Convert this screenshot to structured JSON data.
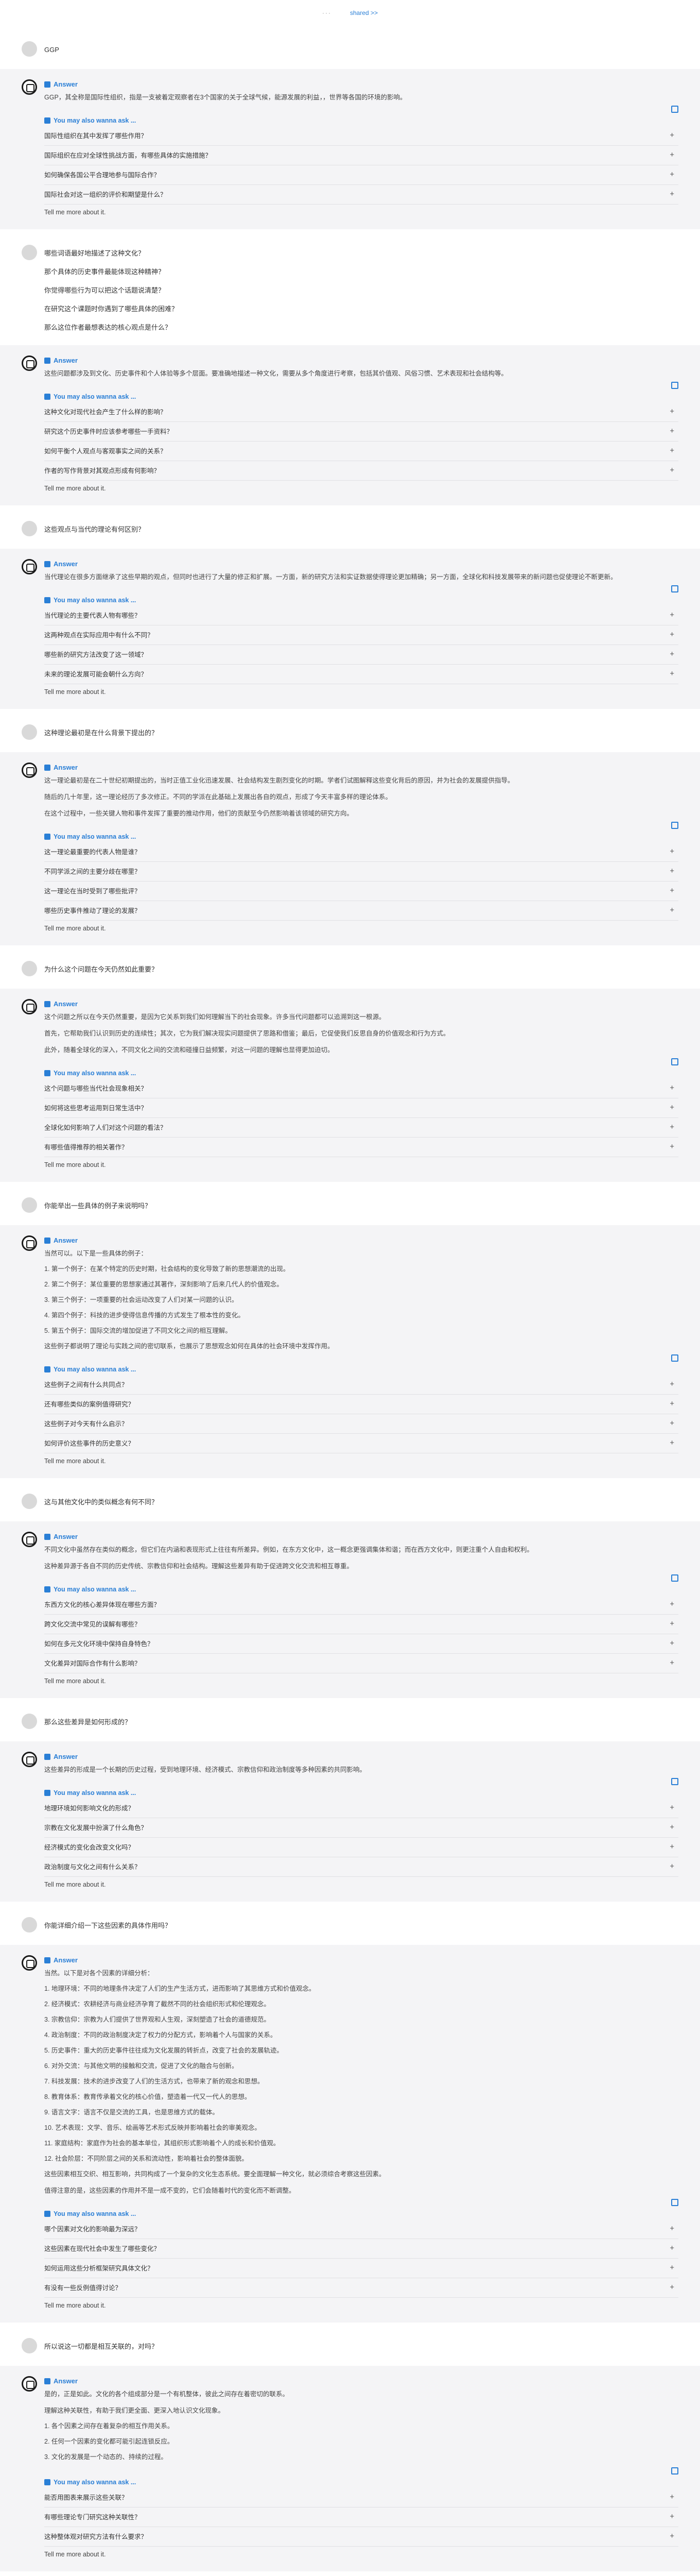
{
  "topbar": {
    "dots": "···",
    "label": "shared >>"
  },
  "labels": {
    "answer": "Answer",
    "ymal": "You may also wanna ask ...",
    "tell_more": "Tell me more about it.",
    "plus": "+"
  },
  "blocks": [
    {
      "question": [
        "GGP"
      ],
      "answer": [
        "GGP，其全称是国际性组织，指是一支被着定观察者在3个国家的关于全球气候，能源发展的利益，，世界等各国的环境的影响。"
      ],
      "suggestions": [
        "国际性组织在其中发挥了哪些作用？",
        "国际组织在应对全球性挑战方面，有哪些具体的实施措施？",
        "如何确保各国公平合理地参与国际合作？",
        "国际社会对这一组织的评价和期望是什么？"
      ]
    },
    {
      "question": [
        "哪些词语最好地描述了这种文化？",
        "那个具体的历史事件最能体现这种精神？",
        "你觉得哪些行为可以把这个话题说清楚？",
        "在研究这个课题时你遇到了哪些具体的困难？",
        "那么这位作者最想表达的核心观点是什么？"
      ],
      "answer": [
        "这些问题都涉及到文化、历史事件和个人体验等多个层面。要准确地描述一种文化，需要从多个角度进行考察，包括其价值观、风俗习惯、艺术表现和社会结构等。"
      ],
      "suggestions": [
        "这种文化对现代社会产生了什么样的影响？",
        "研究这个历史事件时应该参考哪些一手资料？",
        "如何平衡个人观点与客观事实之间的关系？",
        "作者的写作背景对其观点形成有何影响？"
      ]
    },
    {
      "question": [
        "这些观点与当代的理论有何区别？"
      ],
      "answer": [
        "当代理论在很多方面继承了这些早期的观点，但同时也进行了大量的修正和扩展。一方面，新的研究方法和实证数据使得理论更加精确；另一方面，全球化和科技发展带来的新问题也促使理论不断更新。"
      ],
      "suggestions": [
        "当代理论的主要代表人物有哪些？",
        "这两种观点在实际应用中有什么不同？",
        "哪些新的研究方法改变了这一领域？",
        "未来的理论发展可能会朝什么方向？"
      ]
    },
    {
      "question": [
        "这种理论最初是在什么背景下提出的？"
      ],
      "answer": [
        "这一理论最初是在二十世纪初期提出的，当时正值工业化迅速发展、社会结构发生剧烈变化的时期。学者们试图解释这些变化背后的原因，并为社会的发展提供指导。",
        "随后的几十年里，这一理论经历了多次修正。不同的学派在此基础上发展出各自的观点，形成了今天丰富多样的理论体系。",
        "在这个过程中，一些关键人物和事件发挥了重要的推动作用，他们的贡献至今仍然影响着该领域的研究方向。"
      ],
      "suggestions": [
        "这一理论最重要的代表人物是谁？",
        "不同学派之间的主要分歧在哪里？",
        "这一理论在当时受到了哪些批评？",
        "哪些历史事件推动了理论的发展？"
      ]
    },
    {
      "question": [
        "为什么这个问题在今天仍然如此重要？"
      ],
      "answer": [
        "这个问题之所以在今天仍然重要，是因为它关系到我们如何理解当下的社会现象。许多当代问题都可以追溯到这一根源。",
        "首先，它帮助我们认识到历史的连续性；其次，它为我们解决现实问题提供了思路和借鉴；最后，它促使我们反思自身的价值观念和行为方式。",
        "此外，随着全球化的深入，不同文化之间的交流和碰撞日益频繁，对这一问题的理解也显得更加迫切。"
      ],
      "suggestions": [
        "这个问题与哪些当代社会现象相关？",
        "如何将这些思考运用到日常生活中？",
        "全球化如何影响了人们对这个问题的看法？",
        "有哪些值得推荐的相关著作？"
      ]
    },
    {
      "question": [
        "你能举出一些具体的例子来说明吗？"
      ],
      "answer": [
        "当然可以。以下是一些具体的例子："
      ],
      "list": [
        "1. 第一个例子：在某个特定的历史时期，社会结构的变化导致了新的思想潮流的出现。",
        "2. 第二个例子：某位重要的思想家通过其著作，深刻影响了后来几代人的价值观念。",
        "3. 第三个例子：一项重要的社会运动改变了人们对某一问题的认识。",
        "4. 第四个例子：科技的进步使得信息传播的方式发生了根本性的变化。",
        "5. 第五个例子：国际交流的增加促进了不同文化之间的相互理解。"
      ],
      "answer2": [
        "这些例子都说明了理论与实践之间的密切联系，也展示了思想观念如何在具体的社会环境中发挥作用。"
      ],
      "suggestions": [
        "这些例子之间有什么共同点？",
        "还有哪些类似的案例值得研究？",
        "这些例子对今天有什么启示？",
        "如何评价这些事件的历史意义？"
      ]
    },
    {
      "question": [
        "这与其他文化中的类似概念有何不同？"
      ],
      "answer": [
        "不同文化中虽然存在类似的概念，但它们在内涵和表现形式上往往有所差异。例如，在东方文化中，这一概念更强调集体和谐；而在西方文化中，则更注重个人自由和权利。",
        "这种差异源于各自不同的历史传统、宗教信仰和社会结构。理解这些差异有助于促进跨文化交流和相互尊重。"
      ],
      "suggestions": [
        "东西方文化的核心差异体现在哪些方面？",
        "跨文化交流中常见的误解有哪些？",
        "如何在多元文化环境中保持自身特色？",
        "文化差异对国际合作有什么影响？"
      ]
    },
    {
      "question": [
        "那么这些差异是如何形成的？"
      ],
      "answer": [
        "这些差异的形成是一个长期的历史过程，受到地理环境、经济模式、宗教信仰和政治制度等多种因素的共同影响。"
      ],
      "suggestions": [
        "地理环境如何影响文化的形成？",
        "宗教在文化发展中扮演了什么角色？",
        "经济模式的变化会改变文化吗？",
        "政治制度与文化之间有什么关系？"
      ]
    },
    {
      "question": [
        "你能详细介绍一下这些因素的具体作用吗？"
      ],
      "answer": [
        "当然。以下是对各个因素的详细分析："
      ],
      "list": [
        "1. 地理环境：不同的地理条件决定了人们的生产生活方式，进而影响了其思维方式和价值观念。",
        "2. 经济模式：农耕经济与商业经济孕育了截然不同的社会组织形式和伦理观念。",
        "3. 宗教信仰：宗教为人们提供了世界观和人生观，深刻塑造了社会的道德规范。",
        "4. 政治制度：不同的政治制度决定了权力的分配方式，影响着个人与国家的关系。",
        "5. 历史事件：重大的历史事件往往成为文化发展的转折点，改变了社会的发展轨迹。",
        "6. 对外交流：与其他文明的接触和交流，促进了文化的融合与创新。",
        "7. 科技发展：技术的进步改变了人们的生活方式，也带来了新的观念和思想。",
        "8. 教育体系：教育传承着文化的核心价值，塑造着一代又一代人的思想。",
        "9. 语言文字：语言不仅是交流的工具，也是思维方式的载体。",
        "10. 艺术表现：文学、音乐、绘画等艺术形式反映并影响着社会的审美观念。",
        "11. 家庭结构：家庭作为社会的基本单位，其组织形式影响着个人的成长和价值观。",
        "12. 社会阶层：不同阶层之间的关系和流动性，影响着社会的整体面貌。"
      ],
      "answer2": [
        "这些因素相互交织、相互影响，共同构成了一个复杂的文化生态系统。要全面理解一种文化，就必须综合考察这些因素。",
        "值得注意的是，这些因素的作用并不是一成不变的，它们会随着时代的变化而不断调整。"
      ],
      "suggestions": [
        "哪个因素对文化的影响最为深远？",
        "这些因素在现代社会中发生了哪些变化？",
        "如何运用这些分析框架研究具体文化？",
        "有没有一些反例值得讨论？"
      ]
    },
    {
      "question": [
        "所以说这一切都是相互关联的，对吗？"
      ],
      "answer": [
        "是的，正是如此。文化的各个组成部分是一个有机整体，彼此之间存在着密切的联系。",
        "理解这种关联性，有助于我们更全面、更深入地认识文化现象。"
      ],
      "list": [
        "1. 各个因素之间存在着复杂的相互作用关系。",
        "2. 任何一个因素的变化都可能引起连锁反应。",
        "3. 文化的发展是一个动态的、持续的过程。"
      ],
      "suggestions": [
        "能否用图表来展示这些关联？",
        "有哪些理论专门研究这种关联性？",
        "这种整体观对研究方法有什么要求？"
      ]
    }
  ]
}
